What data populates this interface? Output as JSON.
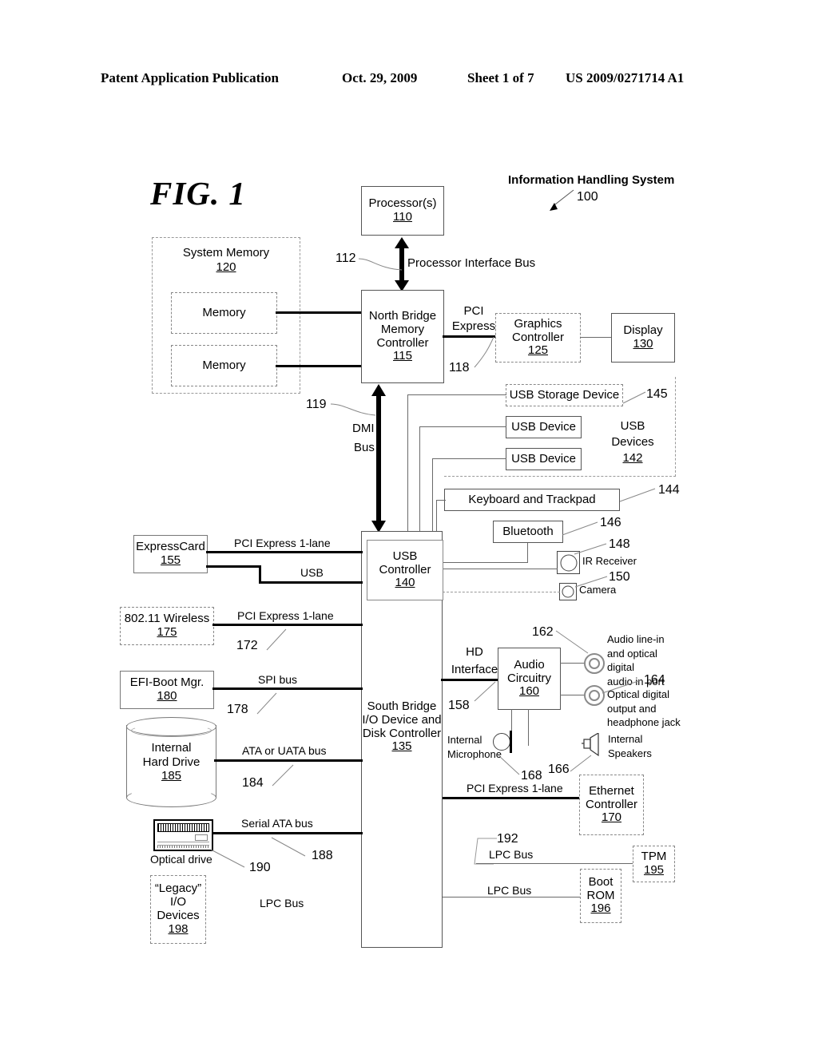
{
  "header": {
    "publication": "Patent Application Publication",
    "date": "Oct. 29, 2009",
    "sheet": "Sheet 1 of 7",
    "number": "US 2009/0271714 A1"
  },
  "figure": {
    "title": "FIG. 1",
    "system_title": "Information Handling System",
    "system_ref": "100"
  },
  "blocks": {
    "processor": {
      "line1": "Processor(s)",
      "ref": "110"
    },
    "north_bridge": {
      "line1": "North Bridge",
      "line2": "Memory",
      "line3": "Controller",
      "ref": "115"
    },
    "memory1": {
      "label": "Memory"
    },
    "memory2": {
      "label": "Memory"
    },
    "graphics": {
      "line1": "Graphics",
      "line2": "Controller",
      "ref": "125"
    },
    "display": {
      "line1": "Display",
      "ref": "130"
    },
    "usb_storage": {
      "label": "USB Storage Device"
    },
    "usb_device_1": {
      "label": "USB Device"
    },
    "usb_device_2": {
      "label": "USB Device"
    },
    "keyboard": {
      "label": "Keyboard and Trackpad"
    },
    "bluetooth": {
      "label": "Bluetooth"
    },
    "usb_controller": {
      "line1": "USB",
      "line2": "Controller",
      "ref": "140"
    },
    "south_bridge": {
      "line1": "South Bridge",
      "line2": "I/O Device and",
      "line3": "Disk Controller",
      "ref": "135"
    },
    "expresscard": {
      "line1": "ExpressCard",
      "ref": "155"
    },
    "wireless": {
      "line1": "802.11 Wireless",
      "ref": "175"
    },
    "efi": {
      "line1": "EFI-Boot Mgr.",
      "ref": "180"
    },
    "hard_drive": {
      "line1": "Internal",
      "line2": "Hard Drive",
      "ref": "185"
    },
    "legacy_io": {
      "line1": "“Legacy”",
      "line2": "I/O",
      "line3": "Devices",
      "ref": "198"
    },
    "audio": {
      "line1": "Audio",
      "line2": "Circuitry",
      "ref": "160"
    },
    "ethernet": {
      "line1": "Ethernet",
      "line2": "Controller",
      "ref": "170"
    },
    "tpm": {
      "line1": "TPM",
      "ref": "195"
    },
    "boot_rom": {
      "line1": "Boot",
      "line2": "ROM",
      "ref": "196"
    }
  },
  "groups": {
    "system_memory": {
      "label": "System Memory",
      "ref": "120"
    },
    "usb_devices": {
      "line1": "USB",
      "line2": "Devices",
      "ref": "142"
    }
  },
  "bus_labels": {
    "processor_interface": "Processor Interface Bus",
    "pci_express_top_1": "PCI",
    "pci_express_top_2": "Express",
    "dmi_1": "DMI",
    "dmi_2": "Bus",
    "pcie_1lane_expresscard": "PCI Express 1-lane",
    "usb": "USB",
    "pcie_1lane_wireless": "PCI Express 1-lane",
    "spi_bus": "SPI bus",
    "ata_uata_bus": "ATA or UATA bus",
    "serial_ata_bus": "Serial ATA bus",
    "lpc_bus_left": "LPC Bus",
    "hd_interface_1": "HD",
    "hd_interface_2": "Interface",
    "pcie_1lane_ethernet": "PCI Express 1-lane",
    "lpc_bus_tpm": "LPC Bus",
    "lpc_bus_boot": "LPC Bus"
  },
  "peripherals": {
    "ir_receiver": "IR Receiver",
    "camera": "Camera",
    "audio_in": "Audio line-in\nand optical digital\naudio in port",
    "audio_out": "Optical digital\noutput and\nheadphone jack",
    "internal_microphone_1": "Internal",
    "internal_microphone_2": "Microphone",
    "internal_speakers_1": "Internal",
    "internal_speakers_2": "Speakers",
    "optical_drive": "Optical drive"
  },
  "reference_numerals": {
    "n112": "112",
    "n118": "118",
    "n119": "119",
    "n144": "144",
    "n145": "145",
    "n146": "146",
    "n148": "148",
    "n150": "150",
    "n158": "158",
    "n162": "162",
    "n164": "164",
    "n166": "166",
    "n168": "168",
    "n172": "172",
    "n178": "178",
    "n184": "184",
    "n188": "188",
    "n190": "190",
    "n192": "192"
  },
  "icons": {
    "hard_drive": "cylinder-icon",
    "optical_drive": "optical-drive-icon",
    "ir_receiver": "ir-receiver-icon",
    "camera": "camera-icon",
    "microphone": "microphone-icon",
    "speaker": "speaker-icon",
    "audio_jack_in": "audio-jack-icon",
    "audio_jack_out": "audio-jack-icon"
  },
  "colors": {
    "ink": "#000000",
    "line": "#555555",
    "dashed": "#999999"
  }
}
